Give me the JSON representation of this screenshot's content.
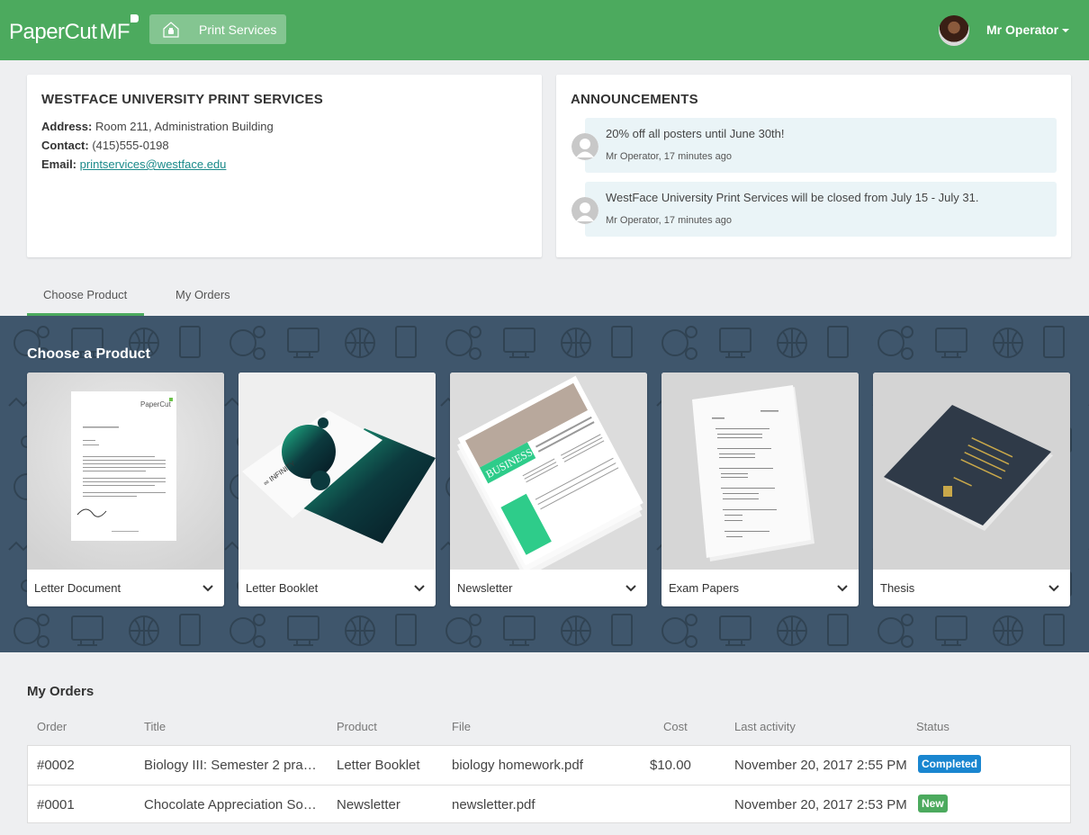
{
  "header": {
    "brand": "PaperCut",
    "brand_suffix": "MF",
    "nav_button": {
      "label": "Print Services",
      "icon": "home-print-icon"
    },
    "user": {
      "name": "Mr Operator",
      "menu_icon": "caret-down-icon"
    },
    "accent_color": "#4caa5e"
  },
  "info_card": {
    "title": "WESTFACE UNIVERSITY PRINT SERVICES",
    "address_label": "Address:",
    "address": "Room 211, Administration Building",
    "contact_label": "Contact:",
    "contact": "(415)555-0198",
    "email_label": "Email:",
    "email": "printservices@westface.edu"
  },
  "announcements": {
    "title": "ANNOUNCEMENTS",
    "items": [
      {
        "text": "20% off all posters until June 30th!",
        "meta": "Mr Operator, 17 minutes ago"
      },
      {
        "text": "WestFace University Print Services will be closed from July 15 - July 31.",
        "meta": "Mr Operator, 17 minutes ago"
      }
    ]
  },
  "tabs": [
    {
      "label": "Choose Product",
      "active": true
    },
    {
      "label": "My Orders",
      "active": false
    }
  ],
  "products": {
    "title": "Choose a Product",
    "items": [
      {
        "label": "Letter Document",
        "image": "letter-document-image"
      },
      {
        "label": "Letter Booklet",
        "image": "letter-booklet-image"
      },
      {
        "label": "Newsletter",
        "image": "newsletter-image"
      },
      {
        "label": "Exam Papers",
        "image": "exam-papers-image"
      },
      {
        "label": "Thesis",
        "image": "thesis-image"
      }
    ]
  },
  "orders": {
    "title": "My Orders",
    "columns": [
      "Order",
      "Title",
      "Product",
      "File",
      "Cost",
      "Last activity",
      "Status"
    ],
    "rows": [
      {
        "order": "#0002",
        "title": "Biology III: Semester 2 pra…",
        "product": "Letter Booklet",
        "file": "biology homework.pdf",
        "cost": "$10.00",
        "last_activity": "November 20, 2017 2:55 PM",
        "status": "Completed",
        "status_color": "#1a86d0"
      },
      {
        "order": "#0001",
        "title": "Chocolate Appreciation So…",
        "product": "Newsletter",
        "file": "newsletter.pdf",
        "cost": "",
        "last_activity": "November 20, 2017 2:53 PM",
        "status": "New",
        "status_color": "#4caa5e"
      }
    ]
  }
}
